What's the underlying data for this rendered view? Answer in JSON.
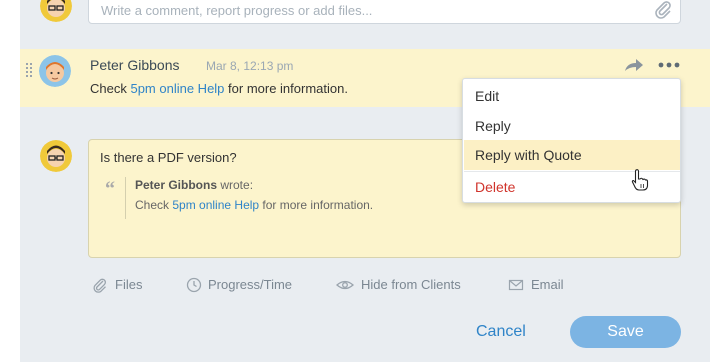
{
  "top_input": {
    "placeholder": "Write a comment, report progress or add files..."
  },
  "comment": {
    "author": "Peter Gibbons",
    "time": "Mar 8, 12:13 pm",
    "text_before": "Check ",
    "link": "5pm online Help",
    "text_after": " for more information."
  },
  "menu": {
    "items": [
      "Edit",
      "Reply",
      "Reply with Quote",
      "Delete"
    ]
  },
  "editor": {
    "text": "Is there a PDF version?",
    "quote_author": "Peter Gibbons",
    "quote_wrote": " wrote:",
    "quote_before": "Check ",
    "quote_link": "5pm online Help",
    "quote_after": " for more information."
  },
  "toolbar": {
    "files": "Files",
    "progress": "Progress/Time",
    "hide": "Hide from Clients",
    "email": "Email"
  },
  "actions": {
    "cancel": "Cancel",
    "save": "Save"
  },
  "colors": {
    "accent": "#2f84c8",
    "save_bg": "#7cb4e3",
    "highlight": "#fcf4cc",
    "danger": "#d0342c"
  }
}
